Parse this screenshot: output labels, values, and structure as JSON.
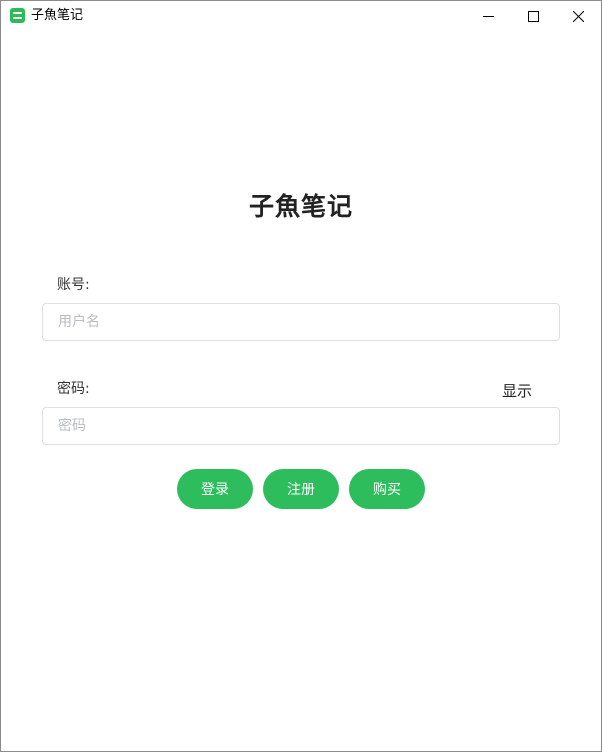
{
  "window": {
    "title": "子魚笔记",
    "icon": "app-logo-icon",
    "controls": {
      "minimize": "minimize-icon",
      "maximize": "maximize-icon",
      "close": "close-icon"
    }
  },
  "login": {
    "title": "子魚笔记",
    "account_label": "账号:",
    "username_placeholder": "用户名",
    "username_value": "",
    "password_label": "密码:",
    "password_placeholder": "密码",
    "password_value": "",
    "show_label": "显示",
    "buttons": {
      "login": "登录",
      "register": "注册",
      "buy": "购买"
    }
  },
  "colors": {
    "accent": "#2dbd5d",
    "input_border": "#dcdfe6",
    "placeholder": "#b8bcc4"
  }
}
